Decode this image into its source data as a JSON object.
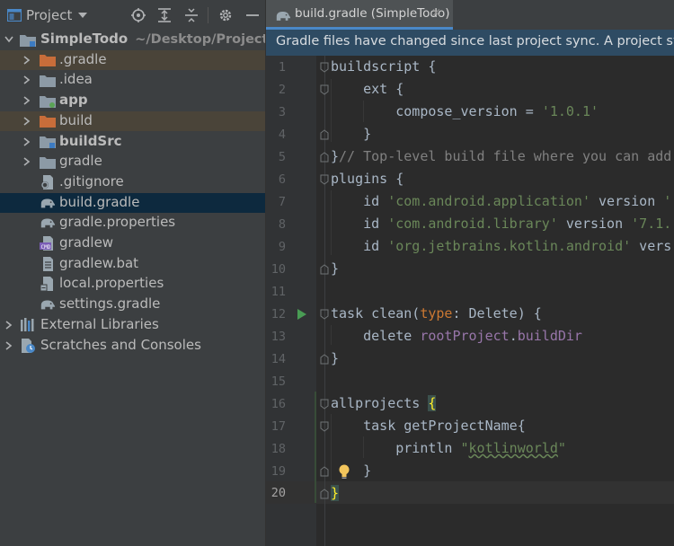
{
  "project_panel": {
    "title": "Project",
    "toolbar_icons": [
      "project-window-icon",
      "dropdown-chevron-icon",
      "locate-icon",
      "expand-all-icon",
      "collapse-all-icon",
      "gear-icon",
      "hide-icon"
    ],
    "root": {
      "label": "SimpleTodo",
      "path": "~/Desktop/Projects/Sir"
    },
    "items": [
      {
        "label": ".gradle",
        "icon": "folder-orange-icon",
        "chevron": true
      },
      {
        "label": ".idea",
        "icon": "folder-icon",
        "chevron": true
      },
      {
        "label": "app",
        "icon": "module-folder-icon",
        "chevron": true,
        "bold": true
      },
      {
        "label": "build",
        "icon": "folder-orange-icon",
        "chevron": true
      },
      {
        "label": "buildSrc",
        "icon": "module-folder-icon",
        "chevron": true,
        "bold": true
      },
      {
        "label": "gradle",
        "icon": "folder-icon",
        "chevron": true
      },
      {
        "label": ".gitignore",
        "icon": "gitignore-file-icon",
        "chevron": false
      },
      {
        "label": "build.gradle",
        "icon": "gradle-elephant-icon",
        "chevron": false
      },
      {
        "label": "gradle.properties",
        "icon": "gradle-elephant-icon",
        "chevron": false
      },
      {
        "label": "gradlew",
        "icon": "shell-script-icon",
        "chevron": false
      },
      {
        "label": "gradlew.bat",
        "icon": "text-file-icon",
        "chevron": false
      },
      {
        "label": "local.properties",
        "icon": "properties-file-icon",
        "chevron": false
      },
      {
        "label": "settings.gradle",
        "icon": "gradle-elephant-icon",
        "chevron": false
      }
    ],
    "external_libraries": "External Libraries",
    "scratches": "Scratches and Consoles"
  },
  "editor": {
    "tab_label": "build.gradle (SimpleTodo)",
    "tab_close": "×",
    "banner": "Gradle files have changed since last project sync. A project sync",
    "current_line": 20,
    "line_numbers": [
      "1",
      "2",
      "3",
      "4",
      "5",
      "6",
      "7",
      "8",
      "9",
      "10",
      "11",
      "12",
      "13",
      "14",
      "15",
      "16",
      "17",
      "18",
      "19",
      "20"
    ],
    "code": {
      "l1_kw": "buildscript",
      "l1_rest": " {",
      "l2_indent": "    ",
      "l2_kw": "ext",
      "l2_rest": " {",
      "l3_pre": "        compose_version = ",
      "l3_str": "'1.0.1'",
      "l4": "    }",
      "l5_br": "}",
      "l5_cm": "// Top-level build file where you can add",
      "l6_kw": "plugins",
      "l6_rest": " {",
      "l7_pre": "    id ",
      "l7_str": "'com.android.application'",
      "l7_mid": " version ",
      "l7_str2": "'",
      "l8_pre": "    id ",
      "l8_str": "'com.android.library'",
      "l8_mid": " version ",
      "l8_str2": "'7.1.",
      "l9_pre": "    id ",
      "l9_str": "'org.jetbrains.kotlin.android'",
      "l9_mid": " vers",
      "l10": "}",
      "l12_kw": "task",
      "l12_name": " clean(",
      "l12_param": "type",
      "l12_rest": ": Delete) {",
      "l13_pre": "    delete ",
      "l13_fld": "rootProject",
      "l13_dot": ".",
      "l13_fld2": "buildDir",
      "l14": "}",
      "l16_name": "allprojects ",
      "l16_br": "{",
      "l17": "    task getProjectName{",
      "l18_pre": "        println ",
      "l18_q1": "\"",
      "l18_str": "kotlinworld",
      "l18_q2": "\"",
      "l19": "    }",
      "l20_br": "}"
    }
  },
  "colors": {
    "panel_bg": "#3c3f41",
    "editor_bg": "#2b2b2b",
    "selection": "#0d293e",
    "excluded_row": "#4a4439",
    "banner_bg": "#2e4b63",
    "keyword": "#cc7832",
    "string": "#6a8759",
    "comment": "#808080",
    "field": "#9876aa"
  }
}
